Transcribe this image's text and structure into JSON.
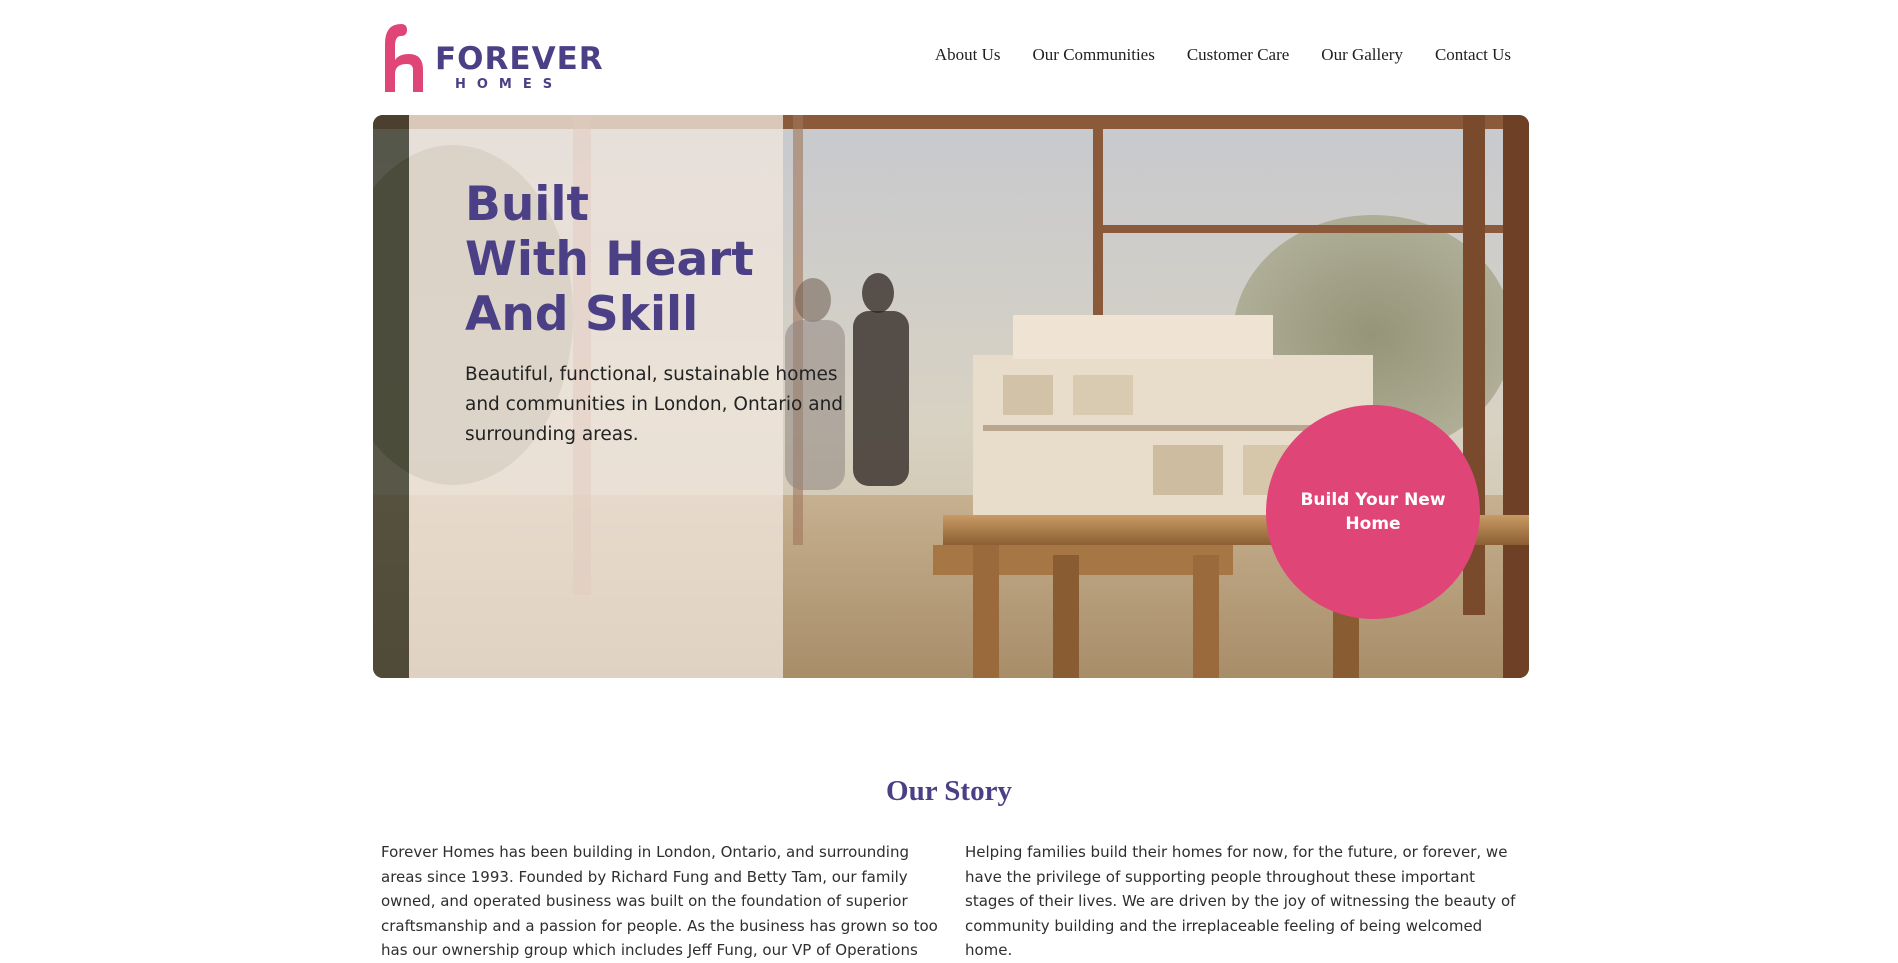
{
  "brand": {
    "name": "FOREVER",
    "sub": "HOMES",
    "colors": {
      "purple": "#4b3f86",
      "pink": "#df4577"
    }
  },
  "nav": {
    "items": [
      {
        "label": "About Us"
      },
      {
        "label": "Our Communities"
      },
      {
        "label": "Customer Care"
      },
      {
        "label": "Our Gallery"
      },
      {
        "label": "Contact Us"
      }
    ]
  },
  "hero": {
    "title_lines": [
      "Built",
      "With Heart",
      "And Skill"
    ],
    "subtitle": "Beautiful, functional, sustainable homes and communities in London, Ontario and surrounding areas.",
    "cta_label": "Build Your New Home"
  },
  "story": {
    "title": "Our Story",
    "left_text": "Forever Homes has been building in London, Ontario, and surrounding areas since 1993. Founded by Richard Fung and Betty Tam, our family owned, and operated business was built on the foundation of superior craftsmanship and a passion for people. As the business has grown so too has our ownership group which includes Jeff Fung, our VP of Operations and Phil Gonzalez, our VP of",
    "right_text": "Helping families build their homes for now, for the future, or forever, we have the privilege of supporting people throughout these important stages of their lives. We are driven by the joy of witnessing the beauty of community building and the irreplaceable feeling of being welcomed home."
  }
}
